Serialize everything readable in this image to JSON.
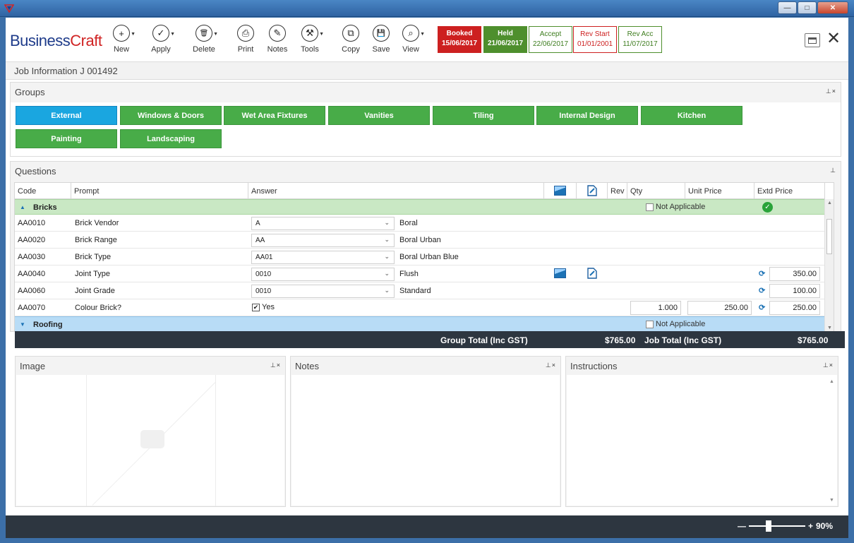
{
  "window": {
    "min": "—",
    "max": "□",
    "close": "✕"
  },
  "brand": {
    "part1": "Business",
    "part2": "Craft"
  },
  "toolbar": [
    {
      "label": "New",
      "icon": "+",
      "caret": true
    },
    {
      "label": "Apply",
      "icon": "✓",
      "caret": true
    },
    {
      "label": "Delete",
      "icon": "🗑",
      "caret": true
    },
    {
      "label": "Print",
      "icon": "⎙",
      "caret": false
    },
    {
      "label": "Notes",
      "icon": "✎",
      "caret": false
    },
    {
      "label": "Tools",
      "icon": "⚒",
      "caret": true
    },
    {
      "label": "Copy",
      "icon": "⧉",
      "caret": false
    },
    {
      "label": "Save",
      "icon": "💾",
      "caret": false
    },
    {
      "label": "View",
      "icon": "⌕",
      "caret": true
    }
  ],
  "statuses": [
    {
      "label": "Booked",
      "date": "15/06/2017"
    },
    {
      "label": "Held",
      "date": "21/06/2017"
    },
    {
      "label": "Accept",
      "date": "22/06/2017"
    },
    {
      "label": "Rev Start",
      "date": "01/01/2001"
    },
    {
      "label": "Rev Acc",
      "date": "11/07/2017"
    }
  ],
  "job_info": "Job Information J 001492",
  "groups": {
    "title": "Groups",
    "pin": "⊥×",
    "buttons": [
      "External",
      "Windows & Doors",
      "Wet Area Fixtures",
      "Vanities",
      "Tiling",
      "Internal Design",
      "Kitchen",
      "Painting",
      "Landscaping"
    ]
  },
  "questions": {
    "title": "Questions",
    "pin": "⊥",
    "columns": {
      "code": "Code",
      "prompt": "Prompt",
      "answer": "Answer",
      "rev": "Rev",
      "qty": "Qty",
      "unit_price": "Unit Price",
      "extd_price": "Extd Price"
    },
    "groups": [
      {
        "name": "Bricks",
        "not_applicable": "Not Applicable"
      },
      {
        "name": "Roofing",
        "not_applicable": "Not Applicable"
      }
    ],
    "rows": [
      {
        "code": "AA0010",
        "prompt": "Brick Vendor",
        "answer": "A",
        "desc": "Boral"
      },
      {
        "code": "AA0020",
        "prompt": "Brick Range",
        "answer": "AA",
        "desc": "Boral Urban"
      },
      {
        "code": "AA0030",
        "prompt": "Brick Type",
        "answer": "AA01",
        "desc": "Boral Urban Blue"
      },
      {
        "code": "AA0040",
        "prompt": "Joint Type",
        "answer": "0010",
        "desc": "Flush",
        "extd": "350.00"
      },
      {
        "code": "AA0060",
        "prompt": "Joint Grade",
        "answer": "0010",
        "desc": "Standard",
        "extd": "100.00"
      },
      {
        "code": "AA0070",
        "prompt": "Colour Brick?",
        "answer": "Yes",
        "qty": "1.000",
        "unit": "250.00",
        "extd": "250.00"
      }
    ]
  },
  "totals": {
    "group_label": "Group Total (Inc GST)",
    "group_value": "$765.00",
    "job_label": "Job Total (Inc GST)",
    "job_value": "$765.00"
  },
  "panels": {
    "image": "Image",
    "notes": "Notes",
    "instructions": "Instructions",
    "pin": "⊥×"
  },
  "zoom": {
    "minus": "—",
    "plus": "+",
    "value": "90%"
  }
}
